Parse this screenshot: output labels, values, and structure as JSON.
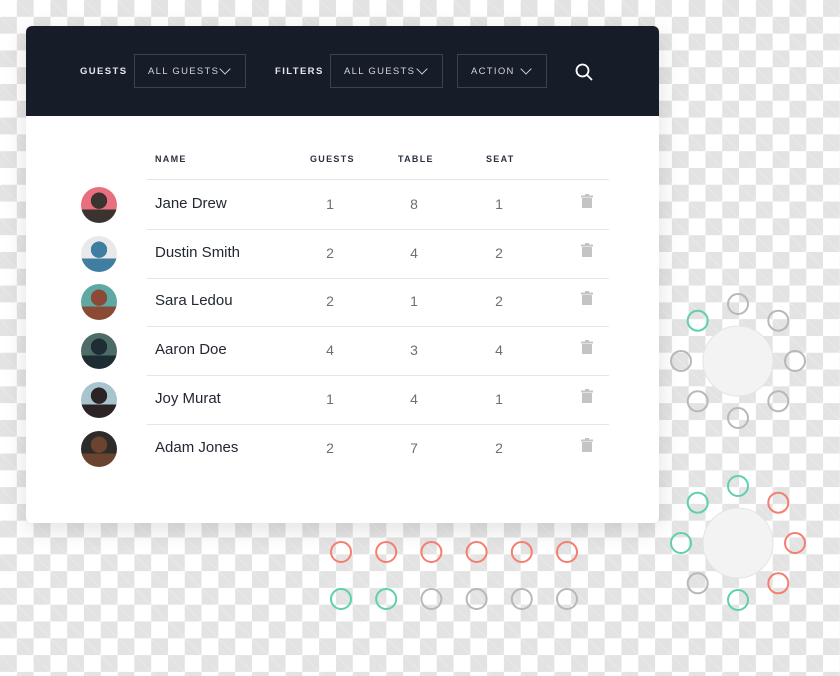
{
  "toolbar": {
    "guests_label": "GUESTS",
    "guests_dropdown": "ALL GUESTS",
    "filters_label": "FILTERS",
    "filters_dropdown": "ALL GUESTS",
    "action_dropdown": "ACTION",
    "search_icon": "search-icon"
  },
  "table": {
    "headers": {
      "name": "NAME",
      "guests": "GUESTS",
      "table": "TABLE",
      "seat": "SEAT"
    },
    "rows": [
      {
        "name": "Jane Drew",
        "guests": "1",
        "table": "8",
        "seat": "1",
        "avatar_colors": [
          "#e8707e",
          "#3a3330"
        ]
      },
      {
        "name": "Dustin Smith",
        "guests": "2",
        "table": "4",
        "seat": "2",
        "avatar_colors": [
          "#e9e9eb",
          "#3f7ea1"
        ]
      },
      {
        "name": "Sara Ledou",
        "guests": "2",
        "table": "1",
        "seat": "2",
        "avatar_colors": [
          "#5ea9a4",
          "#8a4a35"
        ]
      },
      {
        "name": "Aaron Doe",
        "guests": "4",
        "table": "3",
        "seat": "4",
        "avatar_colors": [
          "#4d6c68",
          "#1e2c33"
        ]
      },
      {
        "name": "Joy Murat",
        "guests": "1",
        "table": "4",
        "seat": "1",
        "avatar_colors": [
          "#a8c4cf",
          "#2b2326"
        ]
      },
      {
        "name": "Adam Jones",
        "guests": "2",
        "table": "7",
        "seat": "2",
        "avatar_colors": [
          "#2e2b2b",
          "#6a4331"
        ]
      }
    ],
    "row_action_icon": "trash-icon"
  },
  "seating": {
    "colors": {
      "empty": "#b5b8bc",
      "green": "#5fcfb0",
      "red": "#f47e6f",
      "table_fill": "#f3f3f3"
    },
    "round_table_1": [
      "empty",
      "empty",
      "empty",
      "empty",
      "empty",
      "empty",
      "empty",
      "green"
    ],
    "round_table_2": [
      "green",
      "red",
      "red",
      "red",
      "green",
      "empty",
      "green",
      "green"
    ],
    "row_top": [
      "red",
      "red",
      "red",
      "red",
      "red",
      "red"
    ],
    "row_bottom": [
      "green",
      "green",
      "empty",
      "empty",
      "empty",
      "empty"
    ]
  }
}
